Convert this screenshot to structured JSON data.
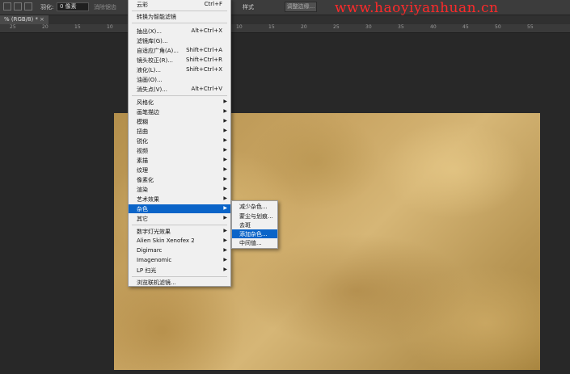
{
  "options_bar": {
    "feather_label": "羽化:",
    "feather_value": "0 像素",
    "antialias_label": "消除锯齿",
    "style_label": "样式",
    "refine_edge_button": "调整边缘..."
  },
  "watermark": "www.haoyiyanhuan.cn",
  "tab": {
    "title": "% (RGB/8) *",
    "close": "×"
  },
  "ruler": {
    "labels": [
      "25",
      "20",
      "15",
      "10",
      "5",
      "0",
      "5",
      "10",
      "15",
      "20",
      "25",
      "30",
      "35",
      "40",
      "45",
      "50",
      "55"
    ]
  },
  "menu": {
    "items": [
      {
        "label": "云彩",
        "shortcut": "Ctrl+F"
      },
      {
        "label": "转换为智能滤镜"
      },
      {
        "label": "抽出(X)...",
        "shortcut": "Alt+Ctrl+X"
      },
      {
        "label": "滤镜库(G)..."
      },
      {
        "label": "自适应广角(A)...",
        "shortcut": "Shift+Ctrl+A"
      },
      {
        "label": "镜头校正(R)...",
        "shortcut": "Shift+Ctrl+R"
      },
      {
        "label": "液化(L)...",
        "shortcut": "Shift+Ctrl+X"
      },
      {
        "label": "油画(O)..."
      },
      {
        "label": "消失点(V)...",
        "shortcut": "Alt+Ctrl+V"
      },
      {
        "label": "风格化",
        "submenu": true
      },
      {
        "label": "画笔描边",
        "submenu": true
      },
      {
        "label": "模糊",
        "submenu": true
      },
      {
        "label": "扭曲",
        "submenu": true
      },
      {
        "label": "锐化",
        "submenu": true
      },
      {
        "label": "视频",
        "submenu": true
      },
      {
        "label": "素描",
        "submenu": true
      },
      {
        "label": "纹理",
        "submenu": true
      },
      {
        "label": "像素化",
        "submenu": true
      },
      {
        "label": "渲染",
        "submenu": true
      },
      {
        "label": "艺术效果",
        "submenu": true
      },
      {
        "label": "杂色",
        "submenu": true,
        "highlighted": true
      },
      {
        "label": "其它",
        "submenu": true
      },
      {
        "label": "数字灯光效果",
        "submenu": true
      },
      {
        "label": "Alien Skin Xenofex 2",
        "submenu": true
      },
      {
        "label": "Digimarc",
        "submenu": true
      },
      {
        "label": "Imagenomic",
        "submenu": true
      },
      {
        "label": "LP 扫光",
        "submenu": true
      },
      {
        "label": "浏览联机滤镜..."
      }
    ]
  },
  "submenu": {
    "items": [
      {
        "label": "减少杂色..."
      },
      {
        "label": "蒙尘与划痕..."
      },
      {
        "label": "去斑"
      },
      {
        "label": "添加杂色...",
        "highlighted": true
      },
      {
        "label": "中间值..."
      }
    ]
  },
  "colors": {
    "menu_highlight": "#0a64c8",
    "canvas_gold": "#c9a563"
  }
}
